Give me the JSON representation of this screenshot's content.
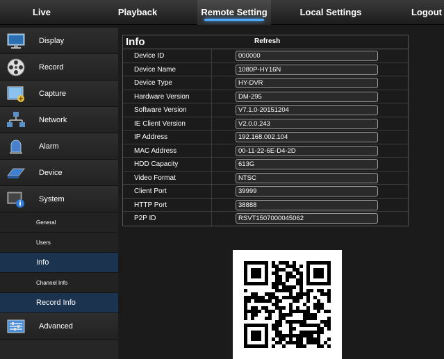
{
  "topnav": {
    "live": "Live",
    "playback": "Playback",
    "remote_setting": "Remote Setting",
    "local_settings": "Local Settings",
    "logout": "Logout"
  },
  "sidebar": {
    "display": "Display",
    "record": "Record",
    "capture": "Capture",
    "network": "Network",
    "alarm": "Alarm",
    "device": "Device",
    "system": "System",
    "general": "General",
    "users": "Users",
    "info": "Info",
    "channel_info": "Channel Info",
    "record_info": "Record Info",
    "advanced": "Advanced"
  },
  "info": {
    "title": "Info",
    "refresh": "Refresh",
    "rows": [
      {
        "label": "Device ID",
        "value": "000000"
      },
      {
        "label": "Device Name",
        "value": "1080P-HY16N"
      },
      {
        "label": "Device Type",
        "value": "HY-DVR"
      },
      {
        "label": "Hardware Version",
        "value": "DM-295"
      },
      {
        "label": "Software Version",
        "value": "V7.1.0-20151204"
      },
      {
        "label": "IE Client Version",
        "value": "V2.0.0.243"
      },
      {
        "label": "IP Address",
        "value": "192.168.002.104"
      },
      {
        "label": "MAC Address",
        "value": "00-11-22-6E-D4-2D"
      },
      {
        "label": "HDD Capacity",
        "value": "613G"
      },
      {
        "label": "Video Format",
        "value": "NTSC"
      },
      {
        "label": "Client Port",
        "value": "39999"
      },
      {
        "label": "HTTP Port",
        "value": "38888"
      },
      {
        "label": "P2P ID",
        "value": "RSVT1507000045062"
      }
    ]
  },
  "colors": {
    "accent": "#4fa8ff",
    "active_bg": "#1c3350"
  }
}
